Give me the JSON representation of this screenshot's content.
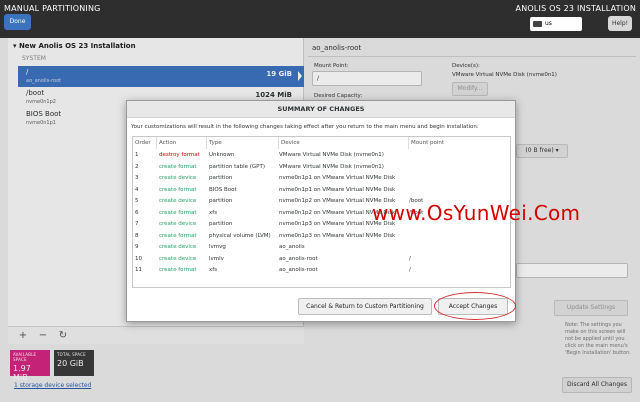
{
  "header": {
    "title": "MANUAL PARTITIONING",
    "done_label": "Done",
    "product": "ANOLIS OS 23 INSTALLATION",
    "keyboard": "us",
    "help_label": "Help!"
  },
  "left_panel": {
    "install_title": "New Anolis OS 23 Installation",
    "system_label": "SYSTEM",
    "partitions": [
      {
        "mount": "/",
        "device": "ao_anolis-root",
        "size": "19 GiB"
      },
      {
        "mount": "/boot",
        "device": "nvme0n1p2",
        "size": "1024 MiB"
      },
      {
        "mount": "BIOS Boot",
        "device": "nvme0n1p1",
        "size": ""
      }
    ],
    "add_icon": "+",
    "remove_icon": "−",
    "refresh_icon": "↻",
    "available_label": "AVAILABLE SPACE",
    "available_value": "1.97 MiB",
    "total_label": "TOTAL SPACE",
    "total_value": "20 GiB",
    "storage_link": "1 storage device selected"
  },
  "right_panel": {
    "title": "ao_anolis-root",
    "mount_point_label": "Mount Point:",
    "mount_point_value": "/",
    "devices_label": "Device(s):",
    "devices_value": "VMware Virtual NVMe Disk (nvme0n1)",
    "modify_label": "Modify...",
    "desired_capacity_label": "Desired Capacity:",
    "free_label": "(0 B free)",
    "update_settings_label": "Update Settings",
    "note": "Note:  The settings you make on this screen will not be applied until you click on the main menu's 'Begin Installation' button.",
    "discard_label": "Discard All Changes"
  },
  "dialog": {
    "title": "SUMMARY OF CHANGES",
    "message": "Your customizations will result in the following changes taking effect after you return to the main menu and begin installation:",
    "columns": [
      "Order",
      "Action",
      "Type",
      "Device",
      "Mount point"
    ],
    "rows": [
      {
        "order": "1",
        "action": "destroy format",
        "type": "Unknown",
        "device": "VMware Virtual NVMe Disk (nvme0n1)",
        "mount": ""
      },
      {
        "order": "2",
        "action": "create format",
        "type": "partition table (GPT)",
        "device": "VMware Virtual NVMe Disk (nvme0n1)",
        "mount": ""
      },
      {
        "order": "3",
        "action": "create device",
        "type": "partition",
        "device": "nvme0n1p1 on VMware Virtual NVMe Disk",
        "mount": ""
      },
      {
        "order": "4",
        "action": "create format",
        "type": "BIOS Boot",
        "device": "nvme0n1p1 on VMware Virtual NVMe Disk",
        "mount": ""
      },
      {
        "order": "5",
        "action": "create device",
        "type": "partition",
        "device": "nvme0n1p2 on VMware Virtual NVMe Disk",
        "mount": "/boot"
      },
      {
        "order": "6",
        "action": "create format",
        "type": "xfs",
        "device": "nvme0n1p2 on VMware Virtual NVMe Disk",
        "mount": "/boot"
      },
      {
        "order": "7",
        "action": "create device",
        "type": "partition",
        "device": "nvme0n1p3 on VMware Virtual NVMe Disk",
        "mount": ""
      },
      {
        "order": "8",
        "action": "create format",
        "type": "physical volume (LVM)",
        "device": "nvme0n1p3 on VMware Virtual NVMe Disk",
        "mount": ""
      },
      {
        "order": "9",
        "action": "create device",
        "type": "lvmvg",
        "device": "ao_anolis",
        "mount": ""
      },
      {
        "order": "10",
        "action": "create device",
        "type": "lvmlv",
        "device": "ao_anolis-root",
        "mount": "/"
      },
      {
        "order": "11",
        "action": "create format",
        "type": "xfs",
        "device": "ao_anolis-root",
        "mount": "/"
      }
    ],
    "cancel_label": "Cancel & Return to Custom Partitioning",
    "accept_label": "Accept Changes"
  },
  "watermark": "www.OsYunWei.Com",
  "colors": {
    "accent": "#3c73c0",
    "available": "#d52580",
    "destroy": "#cc0000",
    "create": "#26a269",
    "annotation": "#d32f2f"
  }
}
